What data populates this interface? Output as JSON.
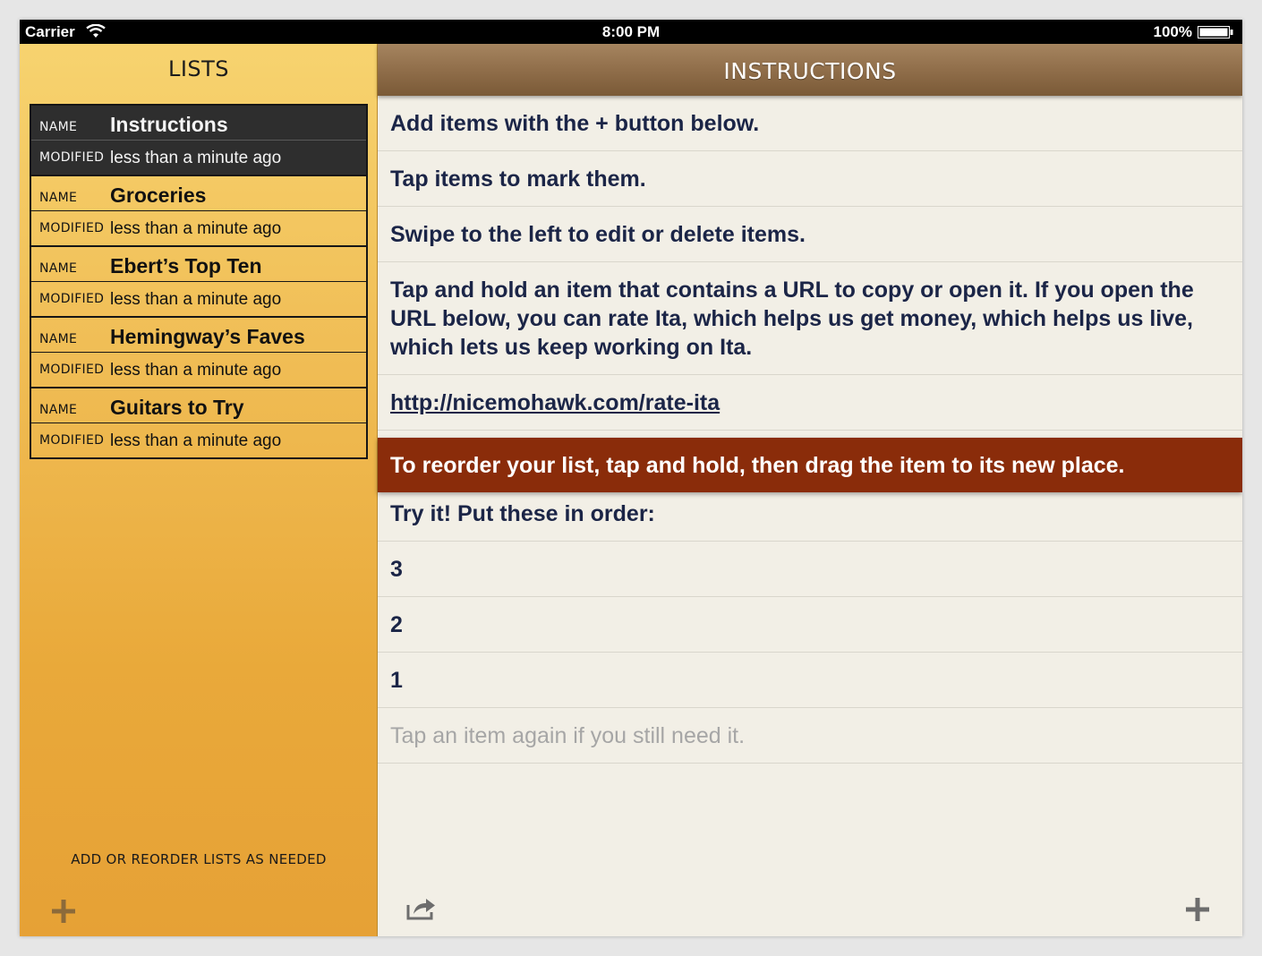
{
  "status_bar": {
    "carrier": "Carrier",
    "time": "8:00 PM",
    "battery": "100%"
  },
  "sidebar": {
    "title": "LISTS",
    "name_label": "NAME",
    "modified_label": "MODIFIED",
    "lists": [
      {
        "name": "Instructions",
        "modified": "less than a minute ago",
        "selected": true
      },
      {
        "name": "Groceries",
        "modified": "less than a minute ago",
        "selected": false
      },
      {
        "name": "Ebert’s Top Ten",
        "modified": "less than a minute ago",
        "selected": false
      },
      {
        "name": "Hemingway’s Faves",
        "modified": "less than a minute ago",
        "selected": false
      },
      {
        "name": "Guitars to Try",
        "modified": "less than a minute ago",
        "selected": false
      }
    ],
    "footer": "ADD OR REORDER LISTS AS NEEDED",
    "add_icon": "plus-icon"
  },
  "main": {
    "title": "INSTRUCTIONS",
    "items": [
      "Add items with the + button below.",
      "Tap items to mark them.",
      "Swipe to the left to edit or delete items.",
      "Tap and hold an item that contains a URL to copy or open it. If you open the URL below, you can rate Ita, which helps us get money, which helps us live, which lets us keep working on Ita.",
      "http://nicemohawk.com/rate-ita",
      "To reorder your list, tap and hold, then drag the item to its new place.",
      "Try it! Put these in order:",
      "3",
      "2",
      "1",
      "Tap an item again if you still need it."
    ],
    "share_icon": "share-icon",
    "add_icon": "plus-icon"
  },
  "colors": {
    "sidebar_top": "#f7d36f",
    "sidebar_bottom": "#e6a136",
    "header_brown": "#8e6c48",
    "highlight_row": "#8a2c0a",
    "item_text": "#1b2547",
    "hint_text": "#a6a6a6"
  }
}
